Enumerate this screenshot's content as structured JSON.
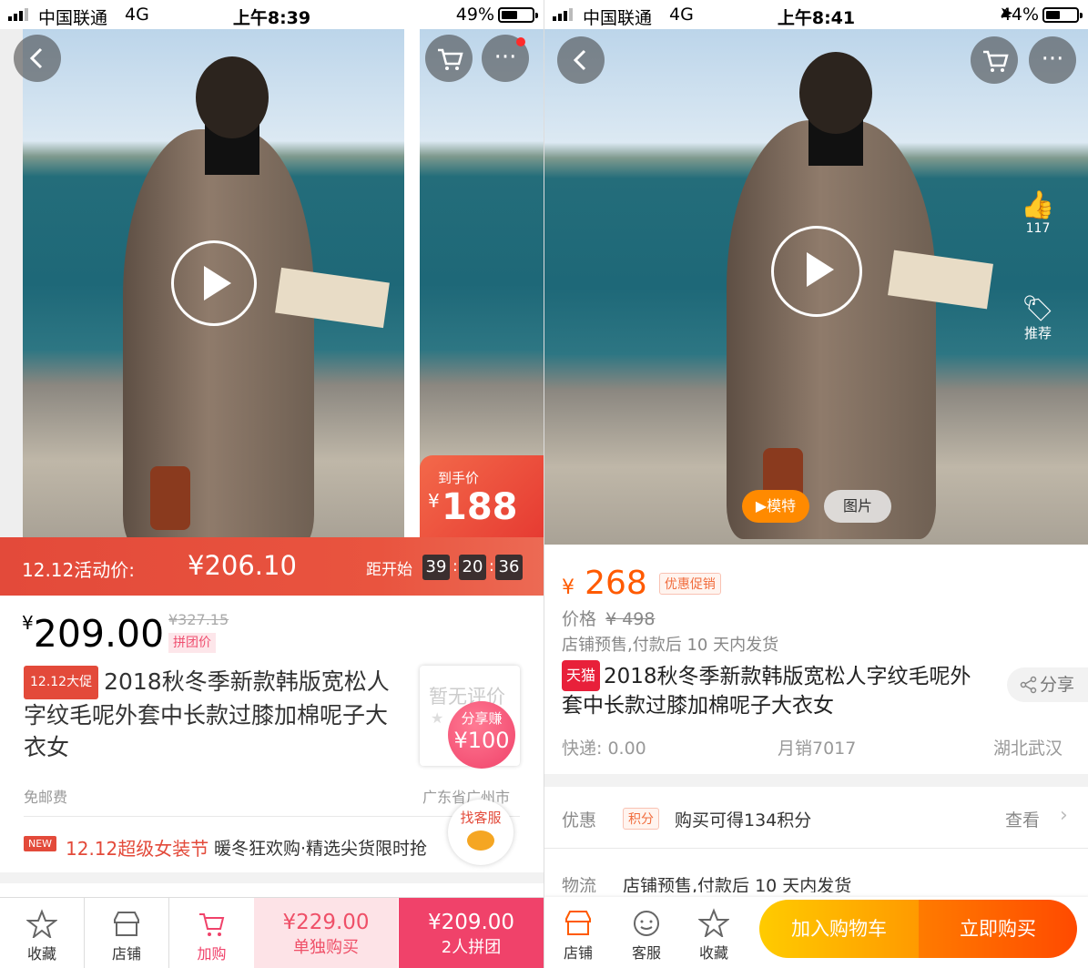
{
  "left": {
    "status": {
      "carrier": "中国联通",
      "network": "4G",
      "time": "上午8:39",
      "battery": "49%"
    },
    "mini_card": {
      "label": "到手价",
      "currency": "¥",
      "price": "188"
    },
    "promo": {
      "label": "12.12活动价:",
      "price": "¥206.10",
      "countdown_label": "距开始",
      "h": "39",
      "m": "20",
      "s": "36"
    },
    "price": {
      "currency": "¥",
      "value": "209.00",
      "original": "¥327.15",
      "tag": "拼团价"
    },
    "title": {
      "badge": "12.12大促",
      "text": "2018秋冬季新款韩版宽松人字纹毛呢外套中长款过膝加棉呢子大衣女"
    },
    "rating": {
      "text": "暂无评价"
    },
    "share_earn": {
      "label": "分享赚",
      "value": "¥100"
    },
    "shipping": "免邮费",
    "location": "广东省广州市",
    "banner": {
      "badge": "NEW",
      "title": "12.12超级女装节",
      "text": "暖冬狂欢购·精选尖货限时抢"
    },
    "service": "找客服",
    "bottom": {
      "fav": "收藏",
      "shop": "店铺",
      "cart": "加购",
      "single_price": "¥229.00",
      "single_label": "单独购买",
      "group_price": "¥209.00",
      "group_label": "2人拼团"
    }
  },
  "right": {
    "status": {
      "carrier": "中国联通",
      "network": "4G",
      "time": "上午8:41",
      "battery": "44%"
    },
    "side": {
      "likes": "117",
      "recommend": "推荐"
    },
    "gallery": {
      "model": "▶模特",
      "pictures": "图片"
    },
    "price": {
      "currency": "¥",
      "value": "268",
      "promo_tag": "优惠促销",
      "orig_label": "价格",
      "original": "¥ 498"
    },
    "presale": "店铺预售,付款后 10 天内发货",
    "title": {
      "badge": "天猫",
      "text": "2018秋冬季新款韩版宽松人字纹毛呢外套中长款过膝加棉呢子大衣女"
    },
    "share": "分享",
    "meta": {
      "express": "快递: 0.00",
      "sales": "月销7017",
      "location": "湖北武汉"
    },
    "offer": {
      "label": "优惠",
      "tag": "积分",
      "text": "购买可得134积分",
      "action": "查看"
    },
    "logistics": {
      "label": "物流",
      "text": "店铺预售,付款后 10 天内发货"
    },
    "bottom": {
      "shop": "店铺",
      "service": "客服",
      "fav": "收藏",
      "add_cart": "加入购物车",
      "buy_now": "立即购买"
    }
  },
  "colors": {
    "red": "#e34a3a",
    "pink": "#f0426a",
    "orange": "#ff5a00",
    "tmall": "#e8203a"
  }
}
